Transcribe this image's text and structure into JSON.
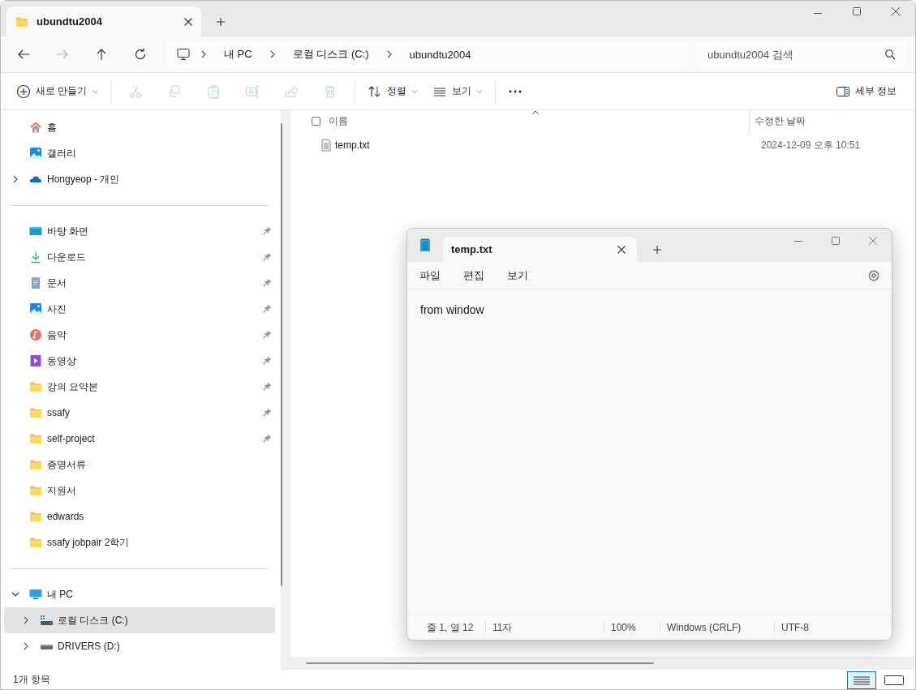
{
  "explorer": {
    "tabs": [
      {
        "label": "ubundtu2004",
        "selected": true
      }
    ],
    "breadcrumb": [
      "내 PC",
      "로컬 디스크 (C:)",
      "ubundtu2004"
    ],
    "search": {
      "placeholder": "ubundtu2004 검색"
    },
    "toolbar": [
      {
        "kind": "new",
        "label": "새로 만들기",
        "disabled": false
      },
      {
        "kind": "cut",
        "disabled": true
      },
      {
        "kind": "copy",
        "disabled": true
      },
      {
        "kind": "paste",
        "disabled": true
      },
      {
        "kind": "rename",
        "disabled": true
      },
      {
        "kind": "share",
        "disabled": true
      },
      {
        "kind": "delete",
        "disabled": true
      },
      {
        "kind": "sort",
        "label": "정렬",
        "disabled": false
      },
      {
        "kind": "view",
        "label": "보기",
        "disabled": false
      },
      {
        "kind": "more",
        "disabled": false
      }
    ],
    "details_button": "세부 정보",
    "sidebar": {
      "groups": [
        {
          "items": [
            {
              "kind": "home",
              "label": "홈",
              "selected": false
            },
            {
              "kind": "gallery",
              "label": "갤러리",
              "selected": false
            },
            {
              "kind": "cloud",
              "label": "Hongyeop - 개인",
              "selected": false,
              "expanded": false
            }
          ]
        },
        {
          "items": [
            {
              "kind": "desktop",
              "label": "바탕 화면",
              "selected": false,
              "pinned": true
            },
            {
              "kind": "download",
              "label": "다운로드",
              "selected": false,
              "pinned": true
            },
            {
              "kind": "documents",
              "label": "문서",
              "selected": false,
              "pinned": true
            },
            {
              "kind": "pictures",
              "label": "사진",
              "selected": false,
              "pinned": true
            },
            {
              "kind": "music",
              "label": "음악",
              "selected": false,
              "pinned": true
            },
            {
              "kind": "videos",
              "label": "동영상",
              "selected": false,
              "pinned": true
            },
            {
              "kind": "folder",
              "label": "강의 요약본",
              "selected": false,
              "pinned": true
            },
            {
              "kind": "folder",
              "label": "ssafy",
              "selected": false,
              "pinned": true
            },
            {
              "kind": "folder",
              "label": "self-project",
              "selected": false,
              "pinned": true
            },
            {
              "kind": "folder",
              "label": "증명서류",
              "selected": false,
              "pinned": false
            },
            {
              "kind": "folder",
              "label": "지원서",
              "selected": false,
              "pinned": false
            },
            {
              "kind": "folder",
              "label": "edwards",
              "selected": false,
              "pinned": false
            },
            {
              "kind": "folder",
              "label": "ssafy jobpair 2학기",
              "selected": false,
              "pinned": false
            }
          ]
        },
        {
          "items": [
            {
              "kind": "pc",
              "label": "내 PC",
              "selected": false,
              "expanded": true,
              "children": [
                {
                  "kind": "windrive",
                  "label": "로컬 디스크 (C:)",
                  "selected": true,
                  "expanded": false
                },
                {
                  "kind": "drive",
                  "label": "DRIVERS (D:)",
                  "selected": false,
                  "expanded": false
                }
              ]
            }
          ]
        }
      ]
    },
    "file_list": {
      "select_all": {
        "checked": false
      },
      "columns": [
        "이름",
        "수정한 날짜"
      ],
      "rows": [
        {
          "kind": "text",
          "name": "temp.txt",
          "modified": "2024-12-09 오후 10:51"
        }
      ]
    },
    "status_bar": {
      "count": "1개 항목",
      "views": [
        {
          "kind": "details",
          "selected": true
        },
        {
          "kind": "tiles",
          "selected": false
        }
      ]
    }
  },
  "notepad": {
    "tabs": [
      {
        "label": "temp.txt",
        "selected": true
      }
    ],
    "menu": [
      "파일",
      "편집",
      "보기"
    ],
    "text": "from window",
    "status_bar": [
      "줄 1, 열 12",
      "11자",
      "100%",
      "Windows (CRLF)",
      "UTF-8"
    ]
  }
}
